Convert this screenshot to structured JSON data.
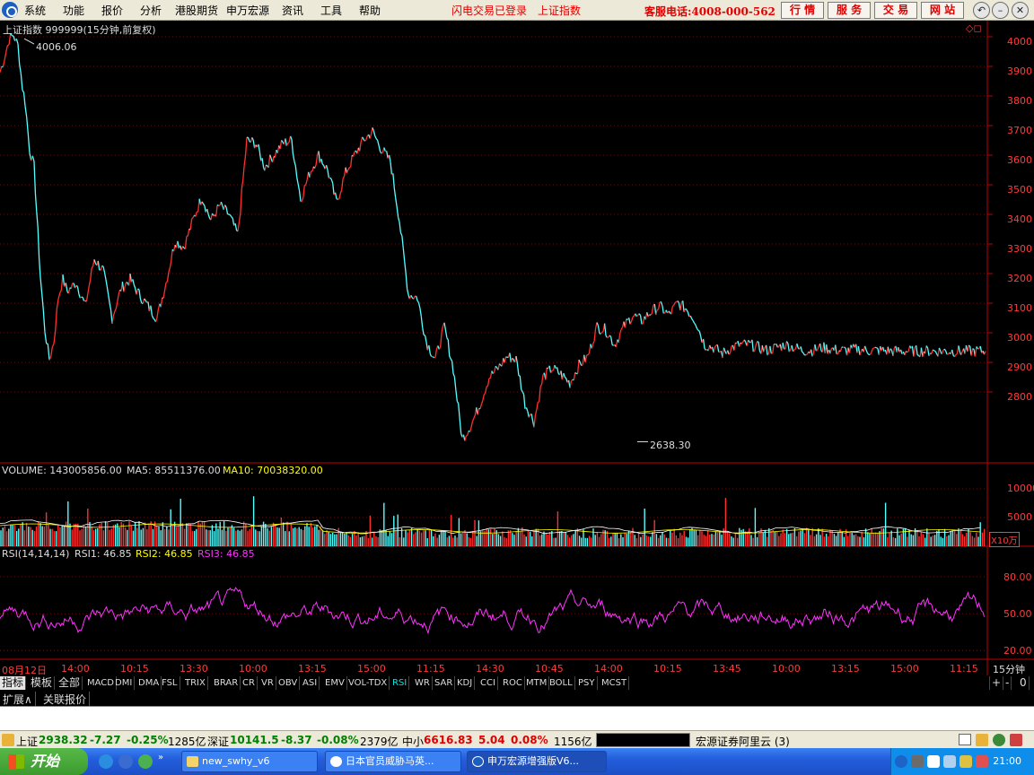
{
  "menu": {
    "items": [
      "系统",
      "功能",
      "报价",
      "分析",
      "港股期货",
      "申万宏源",
      "资讯",
      "工具",
      "帮助"
    ],
    "status_login": "闪电交易已登录",
    "status_index": "上证指数",
    "hotline": "客服电话:4008-000-562",
    "buttons": [
      "行 情",
      "服 务",
      "交 易",
      "网 站"
    ]
  },
  "price_panel": {
    "title": "上证指数 999999(15分钟,前复权)",
    "high_label": "4006.06",
    "low_label": "2638.30",
    "y_ticks": [
      "4000",
      "3900",
      "3800",
      "3700",
      "3600",
      "3500",
      "3400",
      "3300",
      "3200",
      "3100",
      "3000",
      "2900",
      "2800"
    ]
  },
  "volume_panel": {
    "label": "VOLUME: 143005856.00",
    "ma5": "MA5: 85511376.00",
    "ma10": "MA10: 70038320.00",
    "y_ticks": [
      "10000",
      "5000"
    ],
    "unit": "X10万"
  },
  "rsi_panel": {
    "label": "RSI(14,14,14)",
    "rsi1": "RSI1: 46.85",
    "rsi2": "RSI2: 46.85",
    "rsi3": "RSI3: 46.85",
    "y_ticks": [
      "80.00",
      "50.00",
      "20.00"
    ]
  },
  "x_axis": {
    "ticks": [
      "08月12日",
      "14:00",
      "10:15",
      "13:30",
      "10:00",
      "13:15",
      "15:00",
      "11:15",
      "14:30",
      "10:45",
      "14:00",
      "10:15",
      "13:45",
      "10:00",
      "13:15",
      "15:00",
      "11:15"
    ],
    "period": "15分钟"
  },
  "indicator_tabs": {
    "head": [
      "指标",
      "模板",
      "全部"
    ],
    "items": [
      "MACD",
      "DMI",
      "DMA",
      "FSL",
      "TRIX",
      "BRAR",
      "CR",
      "VR",
      "OBV",
      "ASI",
      "EMV",
      "VOL-TDX",
      "RSI",
      "WR",
      "SAR",
      "KDJ",
      "CCI",
      "ROC",
      "MTM",
      "BOLL",
      "PSY",
      "MCST"
    ],
    "active": "RSI",
    "controls": [
      "+",
      "-",
      "0"
    ]
  },
  "ext_row": [
    "扩展∧",
    "关联报价"
  ],
  "status_bar": {
    "sh_name": "上证",
    "sh_value": "2938.32",
    "sh_change": "-7.27",
    "sh_pct": "-0.25%",
    "sh_amount": "1285亿",
    "sz_name": "深证",
    "sz_value": "10141.5",
    "sz_change": "-8.37",
    "sz_pct": "-0.08%",
    "sz_amount": "2379亿",
    "zx_name": "中小",
    "zx_value": "6616.83",
    "zx_change": "5.04",
    "zx_pct": "0.08%",
    "zx_amount": "1156亿",
    "broker": "宏源证券阿里云 (3)"
  },
  "taskbar": {
    "start": "开始",
    "tasks": [
      "new_swhy_v6",
      "日本官员威胁马英...",
      "申万宏源增强版V6..."
    ],
    "clock": "21:00"
  },
  "chart_data": {
    "type": "line",
    "price": {
      "series_note_high": 4006.06,
      "low": 2638.3,
      "ylim": [
        2700,
        4050
      ],
      "x": [
        0,
        5,
        10,
        15,
        20,
        25,
        28,
        33,
        38,
        45,
        50,
        55,
        60,
        65,
        70,
        75,
        85,
        95,
        105,
        115,
        125,
        135,
        145,
        155,
        165,
        175,
        185,
        195,
        205,
        215,
        225,
        235,
        245,
        255,
        265,
        275,
        285,
        295,
        305,
        315,
        325,
        335,
        345,
        355,
        365,
        375,
        385,
        395,
        405,
        415,
        425,
        435,
        445,
        455,
        465,
        475,
        485,
        495,
        505,
        515,
        525,
        535,
        545,
        555,
        565,
        575,
        585,
        595,
        605,
        615,
        625,
        635,
        645,
        655,
        665,
        675,
        685,
        695,
        705,
        715,
        725,
        735,
        745,
        755,
        765,
        775,
        785,
        795,
        805,
        815,
        825,
        835,
        845,
        855,
        865,
        875,
        885,
        895,
        905,
        915,
        925,
        935,
        945,
        955,
        965,
        975,
        985,
        995,
        1005,
        1015,
        1025,
        1035,
        1045,
        1055,
        1065,
        1075,
        1085,
        1098
      ],
      "y": [
        3880,
        3930,
        3990,
        4006,
        3970,
        3830,
        3780,
        3620,
        3560,
        3190,
        3010,
        2910,
        2970,
        3120,
        3180,
        3140,
        3170,
        3090,
        3250,
        3210,
        3050,
        3150,
        3180,
        3130,
        3090,
        3050,
        3170,
        3310,
        3290,
        3380,
        3460,
        3380,
        3430,
        3400,
        3330,
        3650,
        3640,
        3560,
        3600,
        3640,
        3650,
        3450,
        3540,
        3600,
        3550,
        3440,
        3540,
        3600,
        3650,
        3680,
        3620,
        3580,
        3380,
        3130,
        3120,
        2970,
        2910,
        3020,
        2880,
        2640,
        2690,
        2760,
        2850,
        2880,
        2920,
        2910,
        2760,
        2700,
        2850,
        2880,
        2860,
        2830,
        2890,
        2920,
        3020,
        3010,
        2960,
        3020,
        3060,
        3040,
        3070,
        3090,
        3060,
        3100,
        3080,
        3040,
        2960,
        2950,
        2930,
        2950,
        2960,
        2960,
        2950,
        2940,
        2950,
        2960,
        2950,
        2940,
        2940,
        2950,
        2945,
        2940,
        2940,
        2945,
        2940,
        2940,
        2940,
        2938,
        2938,
        2938,
        2938,
        2938,
        2938,
        2938,
        2938,
        2938,
        2938,
        2938
      ]
    },
    "rsi": {
      "ylim": [
        10,
        95
      ],
      "levels": [
        80,
        50,
        20
      ],
      "value": 46.85
    },
    "volume": {
      "ylim": [
        0,
        14000
      ],
      "levels": [
        10000,
        5000
      ]
    }
  }
}
